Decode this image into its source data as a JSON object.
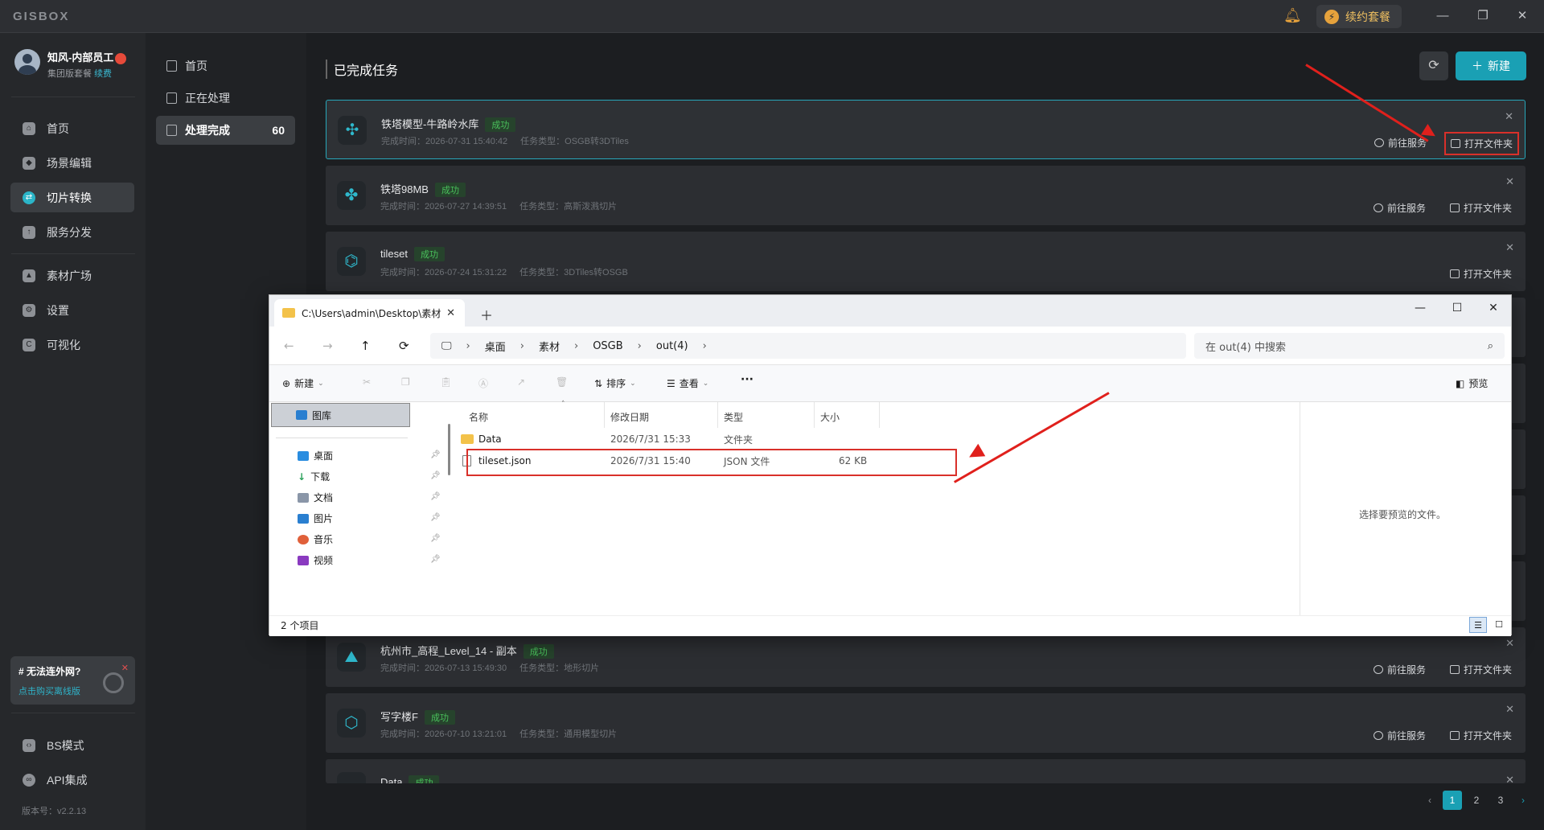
{
  "app": {
    "logo": "GISBOX",
    "renew_label": "续约套餐",
    "window_controls": [
      "minimize",
      "restore",
      "close"
    ]
  },
  "user": {
    "name": "知风-内部员工",
    "plan": "集团版套餐",
    "renew_link": "续费"
  },
  "sidebar": {
    "items": [
      {
        "label": "首页",
        "icon": "home-icon"
      },
      {
        "label": "场景编辑",
        "icon": "cube-icon"
      },
      {
        "label": "切片转换",
        "icon": "convert-icon"
      },
      {
        "label": "服务分发",
        "icon": "upload-icon"
      },
      {
        "label": "素材广场",
        "icon": "image-icon"
      },
      {
        "label": "设置",
        "icon": "gear-icon"
      },
      {
        "label": "可视化",
        "icon": "chart-icon"
      }
    ],
    "active": "切片转换",
    "bottom_items": [
      {
        "label": "BS模式",
        "icon": "code-icon"
      },
      {
        "label": "API集成",
        "icon": "link-icon"
      }
    ],
    "promo": {
      "title": "# 无法连外网?",
      "link": "点击购买离线版"
    },
    "version": "版本号：v2.2.13"
  },
  "subnav": {
    "items": [
      {
        "label": "首页"
      },
      {
        "label": "正在处理"
      },
      {
        "label": "处理完成",
        "count": "60"
      }
    ]
  },
  "main": {
    "title": "已完成任务",
    "new_button": "新建",
    "actions": {
      "goto_service": "前往服务",
      "open_folder": "打开文件夹"
    },
    "tasks": [
      {
        "name": "铁塔模型-牛路岭水库",
        "status": "成功",
        "time": "完成时间：2026-07-31 15:40:42",
        "type": "任务类型：OSGB转3DTiles"
      },
      {
        "name": "铁塔98MB",
        "status": "成功",
        "time": "完成时间：2026-07-27 14:39:51",
        "type": "任务类型：高斯泼溅切片"
      },
      {
        "name": "tileset",
        "status": "成功",
        "time": "完成时间：2026-07-24 15:31:22",
        "type": "任务类型：3DTiles转OSGB"
      },
      {
        "name": "杭州市_高程_Level_14 - 副本",
        "status": "成功",
        "time": "完成时间：2026-07-13 15:49:30",
        "type": "任务类型：地形切片"
      },
      {
        "name": "写字楼F",
        "status": "成功",
        "time": "完成时间：2026-07-10 13:21:01",
        "type": "任务类型：通用模型切片"
      },
      {
        "name": "Data",
        "status": "成功",
        "time": "",
        "type": ""
      }
    ],
    "pages": [
      "1",
      "2",
      "3"
    ]
  },
  "explorer": {
    "tab_title": "C:\\Users\\admin\\Desktop\\素材",
    "breadcrumb": [
      "桌面",
      "素材",
      "OSGB",
      "out(4)"
    ],
    "search_placeholder": "在 out(4) 中搜索",
    "toolbar": {
      "new": "新建",
      "sort": "排序",
      "view": "查看",
      "more": "···",
      "preview": "预览"
    },
    "nav": {
      "library": "图库",
      "quick_access": [
        {
          "label": "桌面",
          "color": "#2a8de0"
        },
        {
          "label": "下载",
          "color": "#2aa05a"
        },
        {
          "label": "文档",
          "color": "#8a96a8"
        },
        {
          "label": "图片",
          "color": "#2a7fd0"
        },
        {
          "label": "音乐",
          "color": "#e0603a"
        },
        {
          "label": "视频",
          "color": "#8a3ac0"
        }
      ]
    },
    "columns": [
      "名称",
      "修改日期",
      "类型",
      "大小"
    ],
    "files": [
      {
        "name": "Data",
        "date": "2026/7/31 15:33",
        "type": "文件夹",
        "size": ""
      },
      {
        "name": "tileset.json",
        "date": "2026/7/31 15:40",
        "type": "JSON 文件",
        "size": "62 KB"
      }
    ],
    "preview_text": "选择要预览的文件。",
    "status": "2 个项目"
  }
}
